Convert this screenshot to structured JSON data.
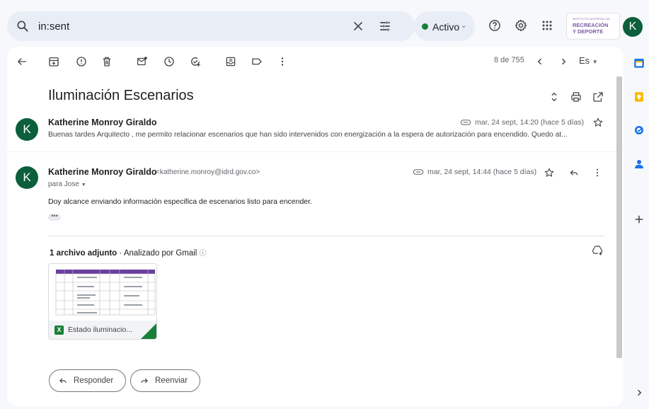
{
  "search": {
    "query": "in:sent"
  },
  "status": {
    "label": "Activo"
  },
  "org_logo": {
    "line1": "INSTITUTO DISTRITAL DE",
    "line2": "RECREACIÓN",
    "line3": "Y DEPORTE"
  },
  "account": {
    "initial": "K"
  },
  "toolbar": {
    "page_count": "8 de 755",
    "language": "Es"
  },
  "thread": {
    "subject": "Iluminación Escenarios",
    "messages": [
      {
        "initial": "K",
        "sender": "Katherine Monroy Giraldo",
        "date": "mar, 24 sept, 14:20 (hace 5 días)",
        "snippet": "Buenas tardes Arquitecto , me permito relacionar escenarios que han sido intervenidos con energización a la espera de autorización para encendido. Quedo at..."
      },
      {
        "initial": "K",
        "sender": "Katherine Monroy Giraldo",
        "email": "<katherine.monroy@idrd.gov.co>",
        "date": "mar, 24 sept, 14:44 (hace 5 días)",
        "to": "para Jose",
        "body": "Doy alcance enviando información especifica de escenarios listo para encender.",
        "ellipsis": "•••"
      }
    ]
  },
  "attachments": {
    "count_label": "1 archivo adjunto",
    "scan_label": "Analizado por Gmail",
    "file_name": "Estado iluminacio...",
    "file_badge": "X"
  },
  "actions": {
    "reply": "Responder",
    "forward": "Reenviar"
  },
  "colors": {
    "accent_green": "#188038",
    "avatar": "#0b5f3a",
    "logo_purple": "#7b5ba6"
  }
}
